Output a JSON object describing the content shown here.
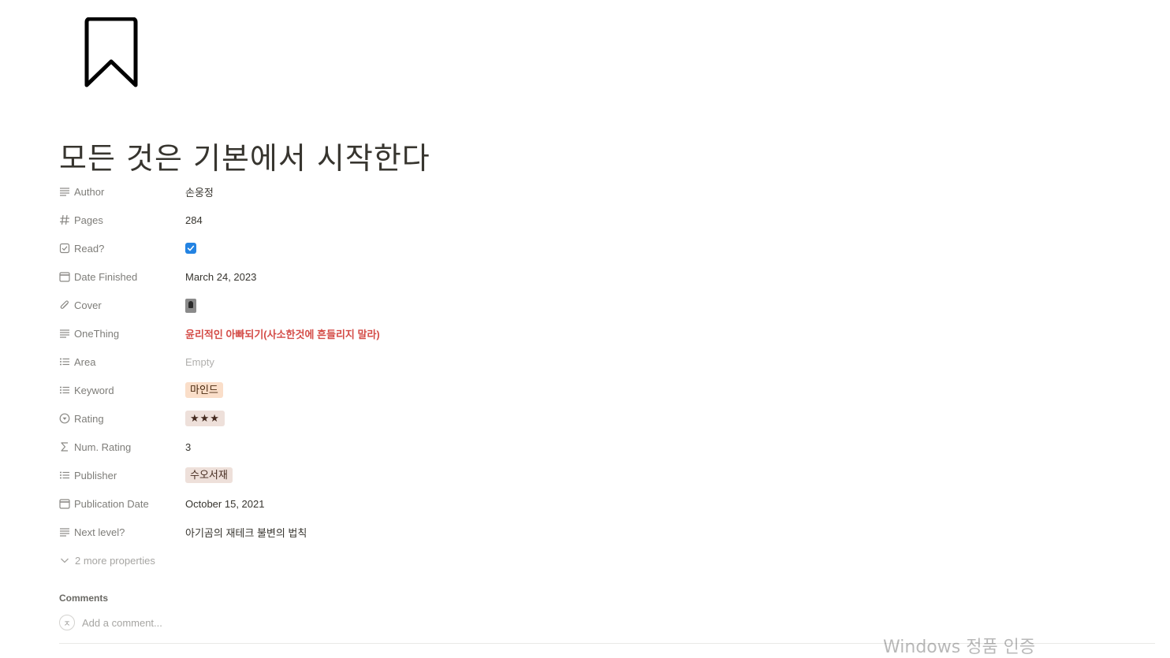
{
  "page": {
    "icon": "bookmark-icon",
    "title": "모든 것은 기본에서 시작한다"
  },
  "properties": {
    "author": {
      "label": "Author",
      "icon": "text-lines-icon",
      "value": "손웅정"
    },
    "pages": {
      "label": "Pages",
      "icon": "hash-icon",
      "value": "284"
    },
    "read": {
      "label": "Read?",
      "icon": "checkbox-icon",
      "checked": true
    },
    "date_finished": {
      "label": "Date Finished",
      "icon": "calendar-icon",
      "value": "March 24, 2023"
    },
    "cover": {
      "label": "Cover",
      "icon": "paperclip-icon"
    },
    "onething": {
      "label": "OneThing",
      "icon": "text-lines-icon",
      "value": "윤리적인 아빠되기(사소한것에 흔들리지 말라)",
      "color": "#d44c47"
    },
    "area": {
      "label": "Area",
      "icon": "list-icon",
      "value": "Empty"
    },
    "keyword": {
      "label": "Keyword",
      "icon": "list-icon",
      "value": "마인드",
      "color": "#fadec9"
    },
    "rating": {
      "label": "Rating",
      "icon": "select-circle-icon",
      "value": "★★★",
      "color": "#eee0da"
    },
    "num_rating": {
      "label": "Num. Rating",
      "icon": "sigma-icon",
      "value": "3"
    },
    "publisher": {
      "label": "Publisher",
      "icon": "list-icon",
      "value": "수오서재",
      "color": "#eee0da"
    },
    "publication_date": {
      "label": "Publication Date",
      "icon": "calendar-icon",
      "value": "October 15, 2021"
    },
    "next_level": {
      "label": "Next level?",
      "icon": "text-lines-icon",
      "value": "아기곰의 재테크 불변의 법칙"
    }
  },
  "more_properties": {
    "label": "2 more properties",
    "icon": "chevron-down-icon"
  },
  "comments": {
    "title": "Comments",
    "avatar_initial": "ㅈ",
    "placeholder": "Add a comment..."
  },
  "watermark": "Windows 정품 인증",
  "colors": {
    "accent": "#2383e2",
    "text": "#37352f"
  }
}
